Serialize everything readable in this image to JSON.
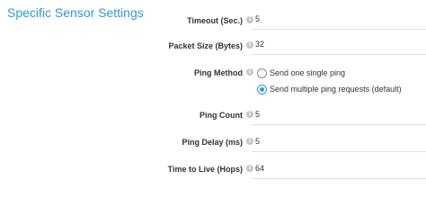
{
  "section": {
    "title": "Specific Sensor Settings"
  },
  "settings": {
    "timeout": {
      "label": "Timeout (Sec.)",
      "value": "5"
    },
    "packet_size": {
      "label": "Packet Size (Bytes)",
      "value": "32"
    },
    "ping_method": {
      "label": "Ping Method",
      "options": [
        {
          "label": "Send one single ping",
          "selected": false
        },
        {
          "label": "Send multiple ping requests (default)",
          "selected": true
        }
      ]
    },
    "ping_count": {
      "label": "Ping Count",
      "value": "5"
    },
    "ping_delay": {
      "label": "Ping Delay (ms)",
      "value": "5"
    },
    "ttl": {
      "label": "Time to Live (Hops)",
      "value": "64"
    }
  },
  "colors": {
    "accent": "#2e9ad8",
    "label": "#333333",
    "info_icon": "#c6c6c6",
    "divider": "#e0e0e0"
  },
  "icons": {
    "help": "info-icon"
  }
}
